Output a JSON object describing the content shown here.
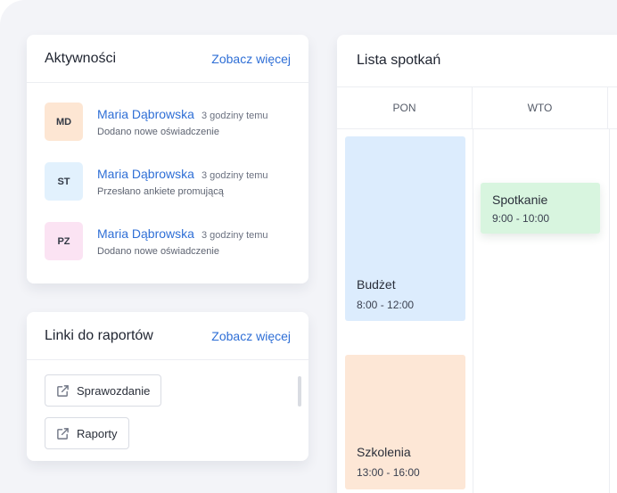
{
  "activities": {
    "title": "Aktywności",
    "more_label": "Zobacz więcej",
    "items": [
      {
        "initials": "MD",
        "avatar_color": "#fde6d3",
        "name": "Maria Dąbrowska",
        "time": "3 godziny temu",
        "description": "Dodano nowe oświadczenie"
      },
      {
        "initials": "ST",
        "avatar_color": "#e2f1fd",
        "name": "Maria Dąbrowska",
        "time": "3 godziny temu",
        "description": "Przesłano ankiete promującą"
      },
      {
        "initials": "PZ",
        "avatar_color": "#fbe3f3",
        "name": "Maria Dąbrowska",
        "time": "3 godziny temu",
        "description": "Dodano nowe oświadczenie"
      }
    ]
  },
  "reports": {
    "title": "Linki do raportów",
    "more_label": "Zobacz więcej",
    "links": [
      {
        "label": "Sprawozdanie",
        "icon": "external-link-icon"
      },
      {
        "label": "Raporty",
        "icon": "external-link-icon"
      }
    ]
  },
  "calendar": {
    "title": "Lista spotkań",
    "days": [
      "PON",
      "WTO"
    ],
    "events": [
      {
        "title": "Budżet",
        "time": "8:00 - 12:00",
        "day": "PON",
        "color": "#dcecfd"
      },
      {
        "title": "Szkolenia",
        "time": "13:00 - 16:00",
        "day": "PON",
        "color": "#fde7d6"
      },
      {
        "title": "Spotkanie",
        "time": "9:00 - 10:00",
        "day": "WTO",
        "color": "#d8f5df"
      }
    ]
  },
  "colors": {
    "accent": "#2f6fd6",
    "background": "#f3f4f8"
  }
}
